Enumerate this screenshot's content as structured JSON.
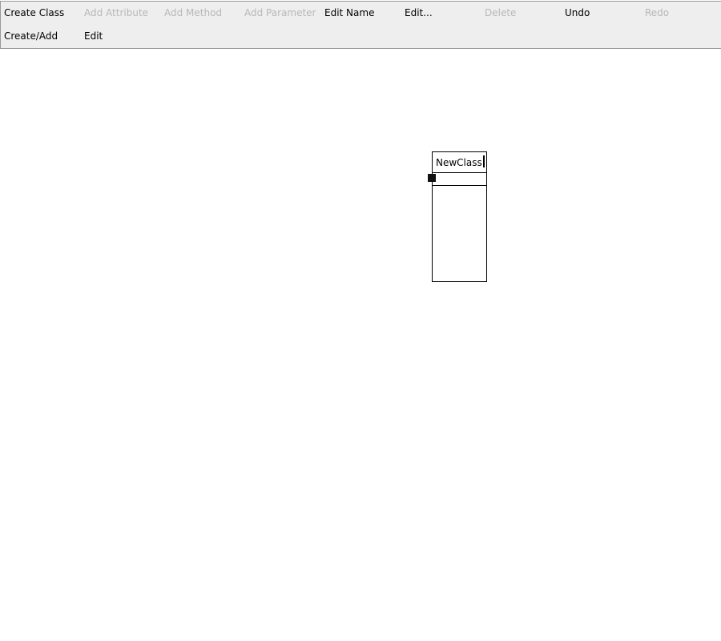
{
  "toolbar": {
    "row1": [
      {
        "label": "Create Class",
        "enabled": true
      },
      {
        "label": "Add Attribute",
        "enabled": false
      },
      {
        "label": "Add Method",
        "enabled": false
      },
      {
        "label": "Add Parameter",
        "enabled": false
      },
      {
        "label": "Edit Name",
        "enabled": true
      },
      {
        "label": "Edit...",
        "enabled": true
      },
      {
        "label": "Delete",
        "enabled": false
      },
      {
        "label": "Undo",
        "enabled": true
      },
      {
        "label": "Redo",
        "enabled": false
      }
    ],
    "row2": [
      {
        "label": "Create/Add",
        "enabled": true
      },
      {
        "label": "Edit",
        "enabled": true
      }
    ]
  },
  "canvas": {
    "classes": [
      {
        "name": "NewClass",
        "editing": true
      }
    ]
  },
  "colors": {
    "toolbar_bg": "#eeeeee",
    "disabled_text": "#b8b8b8",
    "enabled_text": "#000000",
    "border": "#9a9a9a"
  }
}
